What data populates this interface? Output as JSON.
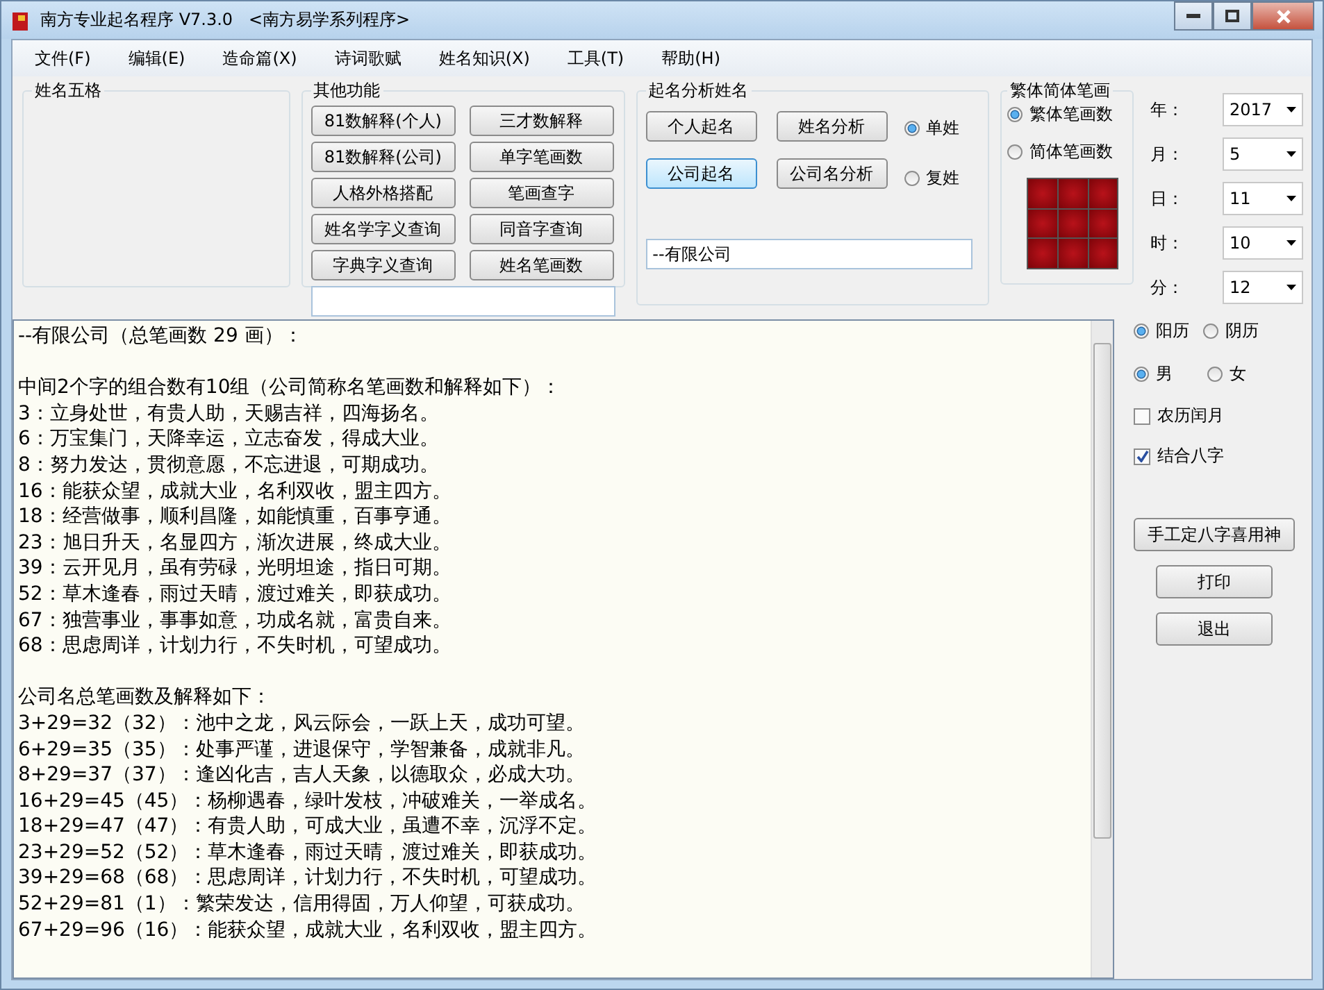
{
  "window": {
    "title": "南方专业起名程序 V7.3.0",
    "subtitle": "<南方易学系列程序>"
  },
  "menu": [
    "文件(F)",
    "编辑(E)",
    "造命篇(X)",
    "诗词歌赋",
    "姓名知识(X)",
    "工具(T)",
    "帮助(H)"
  ],
  "wuge": {
    "title": "姓名五格"
  },
  "other": {
    "title": "其他功能",
    "buttons": [
      "81数解释(个人)",
      "三才数解释",
      "81数解释(公司)",
      "单字笔画数",
      "人格外格搭配",
      "笔画查字",
      "姓名学字义查询",
      "同音字查询",
      "字典字义查询",
      "姓名笔画数"
    ]
  },
  "analysis": {
    "title": "起名分析姓名",
    "buttons": [
      {
        "label": "个人起名",
        "focused": false
      },
      {
        "label": "姓名分析",
        "focused": false
      },
      {
        "label": "公司起名",
        "focused": true
      },
      {
        "label": "公司名分析",
        "focused": false
      }
    ],
    "surname": [
      {
        "label": "单姓",
        "selected": true
      },
      {
        "label": "复姓",
        "selected": false
      }
    ],
    "name_value": "--有限公司"
  },
  "strokes": {
    "title": "繁体简体笔画",
    "options": [
      {
        "label": "繁体笔画数",
        "selected": true
      },
      {
        "label": "简体笔画数",
        "selected": false
      }
    ]
  },
  "date": [
    {
      "label": "年：",
      "value": "2017"
    },
    {
      "label": "月：",
      "value": "5"
    },
    {
      "label": "日：",
      "value": "11"
    },
    {
      "label": "时：",
      "value": "10"
    },
    {
      "label": "分：",
      "value": "12"
    }
  ],
  "calendar": [
    {
      "label": "阳历",
      "selected": true
    },
    {
      "label": "阴历",
      "selected": false
    }
  ],
  "gender": [
    {
      "label": "男",
      "selected": true
    },
    {
      "label": "女",
      "selected": false
    }
  ],
  "checks": [
    {
      "label": "农历闰月",
      "checked": false
    },
    {
      "label": "结合八字",
      "checked": true
    }
  ],
  "actions": [
    "手工定八字喜用神",
    "打印",
    "退出"
  ],
  "output": [
    [
      "--有限公司（总笔画数 29 画）："
    ],
    [
      "中间2个字的组合数有10组（公司简称名笔画数和解释如下）：",
      "3：立身处世，有贵人助，天赐吉祥，四海扬名。",
      "6：万宝集门，天降幸运，立志奋发，得成大业。",
      "8：努力发达，贯彻意愿，不忘进退，可期成功。",
      "16：能获众望，成就大业，名利双收，盟主四方。",
      "18：经营做事，顺利昌隆，如能慎重，百事亨通。",
      "23：旭日升天，名显四方，渐次进展，终成大业。",
      "39：云开见月，虽有劳碌，光明坦途，指日可期。",
      "52：草木逢春，雨过天晴，渡过难关，即获成功。",
      "67：独营事业，事事如意，功成名就，富贵自来。",
      "68：思虑周详，计划力行，不失时机，可望成功。"
    ],
    [
      "公司名总笔画数及解释如下：",
      "3+29=32（32）：池中之龙，风云际会，一跃上天，成功可望。",
      "6+29=35（35）：处事严谨，进退保守，学智兼备，成就非凡。",
      "8+29=37（37）：逢凶化吉，吉人天象，以德取众，必成大功。",
      "16+29=45（45）：杨柳遇春，绿叶发枝，冲破难关，一举成名。",
      "18+29=47（47）：有贵人助，可成大业，虽遭不幸，沉浮不定。",
      "23+29=52（52）：草木逢春，雨过天晴，渡过难关，即获成功。",
      "39+29=68（68）：思虑周详，计划力行，不失时机，可望成功。",
      "52+29=81（1）：繁荣发达，信用得固，万人仰望，可获成功。",
      "67+29=96（16）：能获众望，成就大业，名利双收，盟主四方。"
    ]
  ]
}
